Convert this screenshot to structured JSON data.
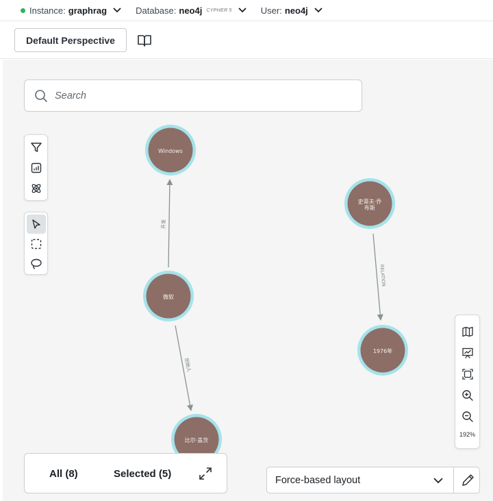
{
  "connection": {
    "instance_label": "Instance:",
    "instance_value": "graphrag",
    "database_label": "Database:",
    "database_value": "neo4j",
    "database_tag": "CYPHER 5",
    "user_label": "User:",
    "user_value": "neo4j",
    "status_color": "#2fb35a"
  },
  "toolbar": {
    "perspective_label": "Default Perspective",
    "book_icon": "book-open-icon"
  },
  "search": {
    "placeholder": "Search",
    "icon": "search-icon"
  },
  "left_tools": {
    "group1": [
      "filter-icon",
      "chart-icon",
      "atom-icon"
    ],
    "group2": [
      "pointer-icon",
      "box-select-icon",
      "lasso-icon"
    ],
    "active": "pointer-icon"
  },
  "graph": {
    "node_color": "#8c6e66",
    "ring_color": "#a5e2ea",
    "nodes": [
      {
        "id": "windows",
        "label": "Windows"
      },
      {
        "id": "weiruan",
        "label": "微软"
      },
      {
        "id": "gaici",
        "label": "比尔·盖茨"
      },
      {
        "id": "jobs",
        "label_line1": "史蒂夫·乔",
        "label_line2": "布斯"
      },
      {
        "id": "y1976",
        "label": "1976年"
      }
    ],
    "edges": [
      {
        "from": "weiruan",
        "to": "windows",
        "label": "开发"
      },
      {
        "from": "weiruan",
        "to": "gaici",
        "label": "创始人"
      },
      {
        "from": "jobs",
        "to": "y1976",
        "label": "RELATION"
      }
    ]
  },
  "right_tools": {
    "icons": [
      "map-icon",
      "presentation-icon",
      "fit-screen-icon",
      "zoom-in-icon",
      "zoom-out-icon"
    ],
    "zoom_level": "192%"
  },
  "results": {
    "all_label": "All (8)",
    "selected_label": "Selected (5)"
  },
  "layout": {
    "current": "Force-based layout"
  }
}
